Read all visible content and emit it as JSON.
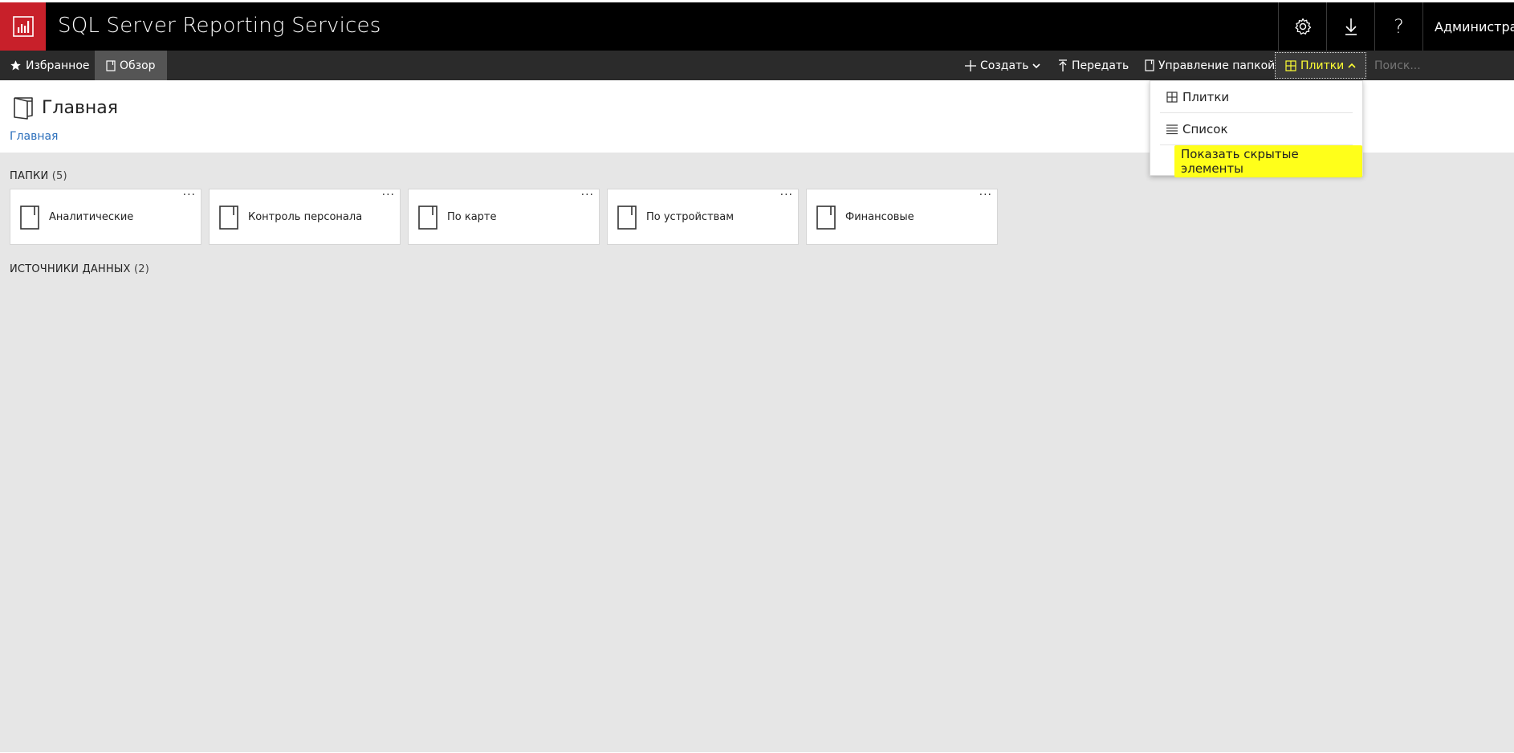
{
  "header": {
    "app_title": "SQL Server Reporting Services",
    "user_name": "Администратор",
    "brand_color": "#c8202a",
    "icons": [
      "chart-logo-icon",
      "gear-icon",
      "download-icon",
      "help-icon"
    ]
  },
  "toolbar": {
    "favorites_label": "Избранное",
    "browse_label": "Обзор",
    "create_label": "Создать",
    "upload_label": "Передать",
    "manage_folder_label": "Управление папкой",
    "tiles_label": "Плитки",
    "search_placeholder": "Поиск..."
  },
  "page": {
    "title": "Главная",
    "breadcrumb": "Главная"
  },
  "folders_section": {
    "label": "ПАПКИ",
    "count": "(5)",
    "items": [
      {
        "label": "Аналитические"
      },
      {
        "label": "Контроль персонала"
      },
      {
        "label": "По карте"
      },
      {
        "label": "По устройствам"
      },
      {
        "label": "Финансовые"
      }
    ]
  },
  "datasources_section": {
    "label": "ИСТОЧНИКИ ДАННЫХ",
    "count": "(2)"
  },
  "view_menu": {
    "items": [
      {
        "label": "Плитки"
      },
      {
        "label": "Список"
      },
      {
        "label": "Показать скрытые элементы"
      }
    ],
    "highlight_color": "#ffff1a"
  }
}
